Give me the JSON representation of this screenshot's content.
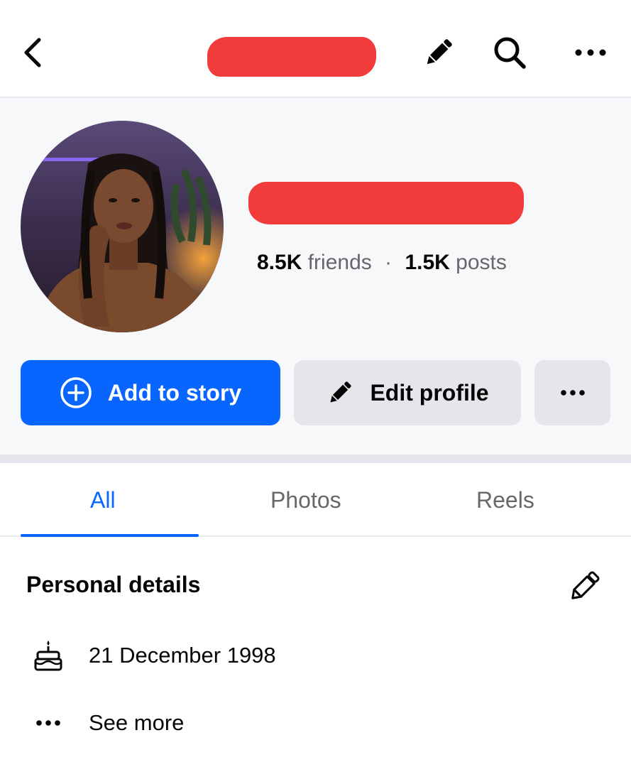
{
  "header": {
    "back_icon": "chevron-left-icon",
    "edit_icon": "pencil-icon",
    "search_icon": "search-icon",
    "more_icon": "more-horizontal-icon"
  },
  "profile": {
    "friends_count": "8.5K",
    "friends_label": "friends",
    "separator": "·",
    "posts_count": "1.5K",
    "posts_label": "posts"
  },
  "actions": {
    "add_story_label": "Add to story",
    "add_story_icon": "plus-circle-icon",
    "edit_profile_label": "Edit profile",
    "edit_profile_icon": "pencil-icon",
    "more_icon": "more-horizontal-icon",
    "primary_color": "#0866ff"
  },
  "tabs": [
    {
      "label": "All",
      "active": true
    },
    {
      "label": "Photos",
      "active": false
    },
    {
      "label": "Reels",
      "active": false
    }
  ],
  "personal_details": {
    "title": "Personal details",
    "edit_icon": "pencil-outline-icon",
    "birthday_icon": "birthday-cake-icon",
    "birthday": "21 December 1998",
    "see_more_icon": "more-horizontal-icon",
    "see_more_label": "See more"
  }
}
